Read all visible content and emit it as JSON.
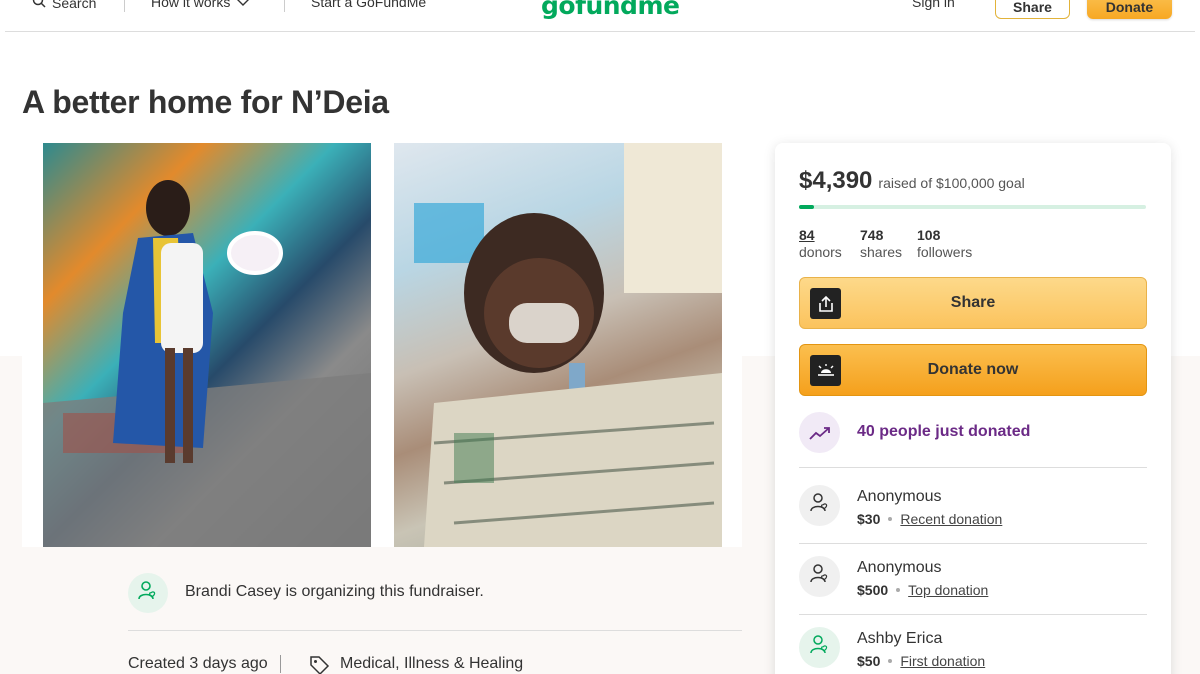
{
  "header": {
    "search_label": "Search",
    "how_it_works_label": "How it works",
    "start_label": "Start a GoFundMe",
    "logo_text": "gofundme",
    "sign_in_label": "Sign in",
    "share_label": "Share",
    "donate_label": "Donate"
  },
  "campaign": {
    "title": "A better home for N’Deia",
    "organizer_text": "Brandi Casey is organizing this fundraiser.",
    "created": "Created 3 days ago",
    "category": "Medical, Illness & Healing"
  },
  "donation_card": {
    "raised_amount": "$4,390",
    "goal_text": "raised of $100,000 goal",
    "progress_fraction": 0.044,
    "stats": [
      {
        "value": "84",
        "label": "donors"
      },
      {
        "value": "748",
        "label": "shares"
      },
      {
        "value": "108",
        "label": "followers"
      }
    ],
    "share_button": "Share",
    "donate_button": "Donate now",
    "trend_text": "40 people just donated",
    "donations": [
      {
        "name": "Anonymous",
        "amount": "$30",
        "tag": "Recent donation"
      },
      {
        "name": "Anonymous",
        "amount": "$500",
        "tag": "Top donation"
      },
      {
        "name": "Ashby Erica",
        "amount": "$50",
        "tag": "First donation"
      }
    ]
  },
  "colors": {
    "brand_green": "#02a95c",
    "donate_orange": "#f7a823",
    "trend_purple": "#6b2a86"
  }
}
